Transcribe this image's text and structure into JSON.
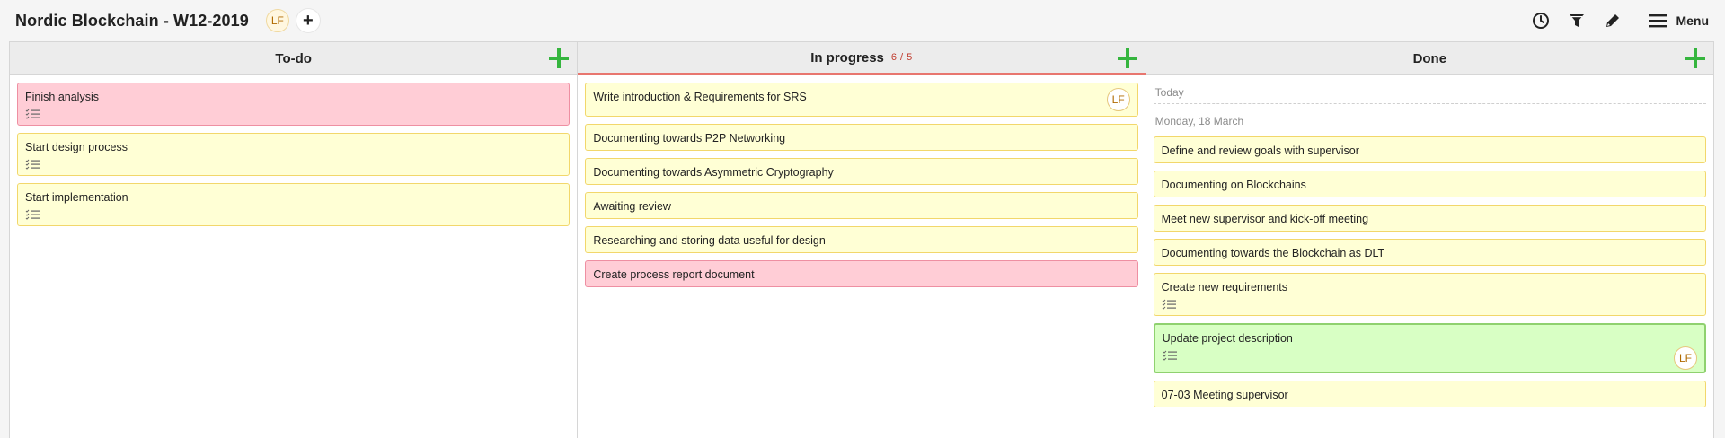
{
  "header": {
    "title": "Nordic Blockchain - W12-2019",
    "user_initials": "LF",
    "add_label": "+",
    "menu_label": "Menu"
  },
  "columns": [
    {
      "title": "To-do",
      "cards": [
        {
          "text": "Finish analysis",
          "color": "pink",
          "has_checklist": true
        },
        {
          "text": "Start design process",
          "color": "yellow",
          "has_checklist": true
        },
        {
          "text": "Start implementation",
          "color": "yellow",
          "has_checklist": true
        }
      ]
    },
    {
      "title": "In progress",
      "wip": "6 / 5",
      "cards": [
        {
          "text": "Write introduction & Requirements for SRS",
          "color": "yellow",
          "avatar": "LF"
        },
        {
          "text": "Documenting towards P2P Networking",
          "color": "yellow"
        },
        {
          "text": "Documenting towards Asymmetric Cryptography",
          "color": "yellow"
        },
        {
          "text": "Awaiting review",
          "color": "yellow"
        },
        {
          "text": "Researching and storing data useful for design",
          "color": "yellow"
        },
        {
          "text": "Create process report document",
          "color": "pink"
        }
      ]
    },
    {
      "title": "Done",
      "groups": [
        {
          "label": "Today",
          "cards": []
        },
        {
          "label": "Monday, 18 March",
          "cards": [
            {
              "text": "Define and review goals with supervisor",
              "color": "yellow"
            },
            {
              "text": "Documenting on Blockchains",
              "color": "yellow"
            },
            {
              "text": "Meet new supervisor and kick-off meeting",
              "color": "yellow"
            },
            {
              "text": "Documenting towards the Blockchain as DLT",
              "color": "yellow"
            },
            {
              "text": "Create new requirements",
              "color": "yellow",
              "has_checklist": true
            },
            {
              "text": "Update project description",
              "color": "green",
              "has_checklist": true,
              "avatar": "LF"
            },
            {
              "text": "07-03 Meeting supervisor",
              "color": "yellow"
            }
          ]
        }
      ]
    }
  ],
  "colors": {
    "yellow_card": "#ffffd5",
    "pink_card": "#ffcdd6",
    "green_card": "#d8ffc4",
    "add_green": "#35b53e",
    "wip_red": "#c0392b"
  },
  "icons": [
    "clock-icon",
    "filter-icon",
    "pencil-icon",
    "hamburger-icon",
    "plus-icon",
    "checklist-icon"
  ]
}
